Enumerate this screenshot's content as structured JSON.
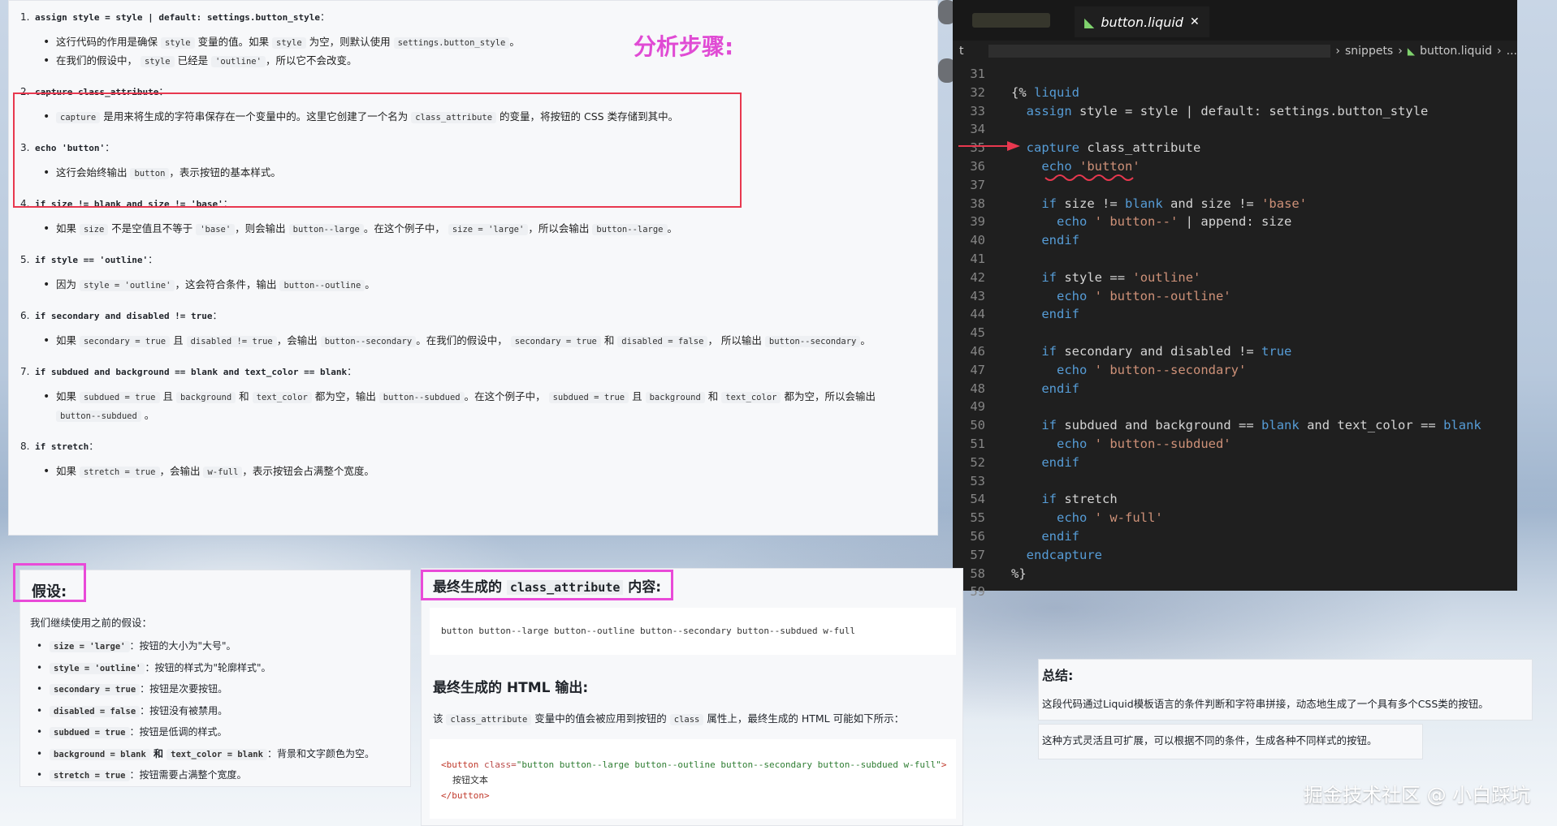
{
  "title_annotation": "分析步骤:",
  "steps": [
    {
      "num": "1.",
      "code": "assign style = style | default: settings.button_style",
      "tail": "：",
      "bullets": [
        {
          "parts": [
            {
              "t": "这行代码的作用是确保 "
            },
            {
              "c": "style"
            },
            {
              "t": " 变量的值。如果 "
            },
            {
              "c": "style"
            },
            {
              "t": " 为空，则默认使用 "
            },
            {
              "c": "settings.button_style"
            },
            {
              "t": "。"
            }
          ]
        },
        {
          "parts": [
            {
              "t": "在我们的假设中， "
            },
            {
              "c": "style"
            },
            {
              "t": " 已经是 "
            },
            {
              "c": "'outline'"
            },
            {
              "t": "，所以它不会改变。"
            }
          ]
        }
      ]
    },
    {
      "num": "2.",
      "code": "capture class_attribute",
      "tail": "：",
      "bullets": [
        {
          "parts": [
            {
              "c": "capture"
            },
            {
              "t": " 是用来将生成的字符串保存在一个变量中的。这里它创建了一个名为 "
            },
            {
              "c": "class_attribute"
            },
            {
              "t": " 的变量，将按钮的 CSS 类存储到其中。"
            }
          ]
        }
      ]
    },
    {
      "num": "3.",
      "code": "echo 'button'",
      "tail": "：",
      "bullets": [
        {
          "parts": [
            {
              "t": "这行会始终输出 "
            },
            {
              "c": "button"
            },
            {
              "t": "，表示按钮的基本样式。"
            }
          ]
        }
      ]
    },
    {
      "num": "4.",
      "code": "if size != blank and size != 'base'",
      "tail": "：",
      "bullets": [
        {
          "parts": [
            {
              "t": "如果 "
            },
            {
              "c": "size"
            },
            {
              "t": " 不是空值且不等于 "
            },
            {
              "c": "'base'"
            },
            {
              "t": "，则会输出 "
            },
            {
              "c": "button--large"
            },
            {
              "t": "。在这个例子中， "
            },
            {
              "c": "size = 'large'"
            },
            {
              "t": "，所以会输出 "
            },
            {
              "c": "button--large"
            },
            {
              "t": "。"
            }
          ]
        }
      ]
    },
    {
      "num": "5.",
      "code": "if style == 'outline'",
      "tail": "：",
      "bullets": [
        {
          "parts": [
            {
              "t": "因为 "
            },
            {
              "c": "style = 'outline'"
            },
            {
              "t": "，这会符合条件，输出 "
            },
            {
              "c": "button--outline"
            },
            {
              "t": "。"
            }
          ]
        }
      ]
    },
    {
      "num": "6.",
      "code": "if secondary and disabled != true",
      "tail": "：",
      "bullets": [
        {
          "parts": [
            {
              "t": "如果 "
            },
            {
              "c": "secondary = true"
            },
            {
              "t": " 且 "
            },
            {
              "c": "disabled != true"
            },
            {
              "t": "，会输出 "
            },
            {
              "c": "button--secondary"
            },
            {
              "t": "。在我们的假设中， "
            },
            {
              "c": "secondary = true"
            },
            {
              "t": " 和 "
            },
            {
              "c": "disabled = false"
            },
            {
              "t": "， 所以输出 "
            },
            {
              "c": "button--secondary"
            },
            {
              "t": "。"
            }
          ]
        }
      ]
    },
    {
      "num": "7.",
      "code": "if subdued and background == blank and text_color == blank",
      "tail": "：",
      "bullets": [
        {
          "parts": [
            {
              "t": "如果 "
            },
            {
              "c": "subdued = true"
            },
            {
              "t": " 且 "
            },
            {
              "c": "background"
            },
            {
              "t": " 和 "
            },
            {
              "c": "text_color"
            },
            {
              "t": " 都为空，输出 "
            },
            {
              "c": "button--subdued"
            },
            {
              "t": "。在这个例子中， "
            },
            {
              "c": "subdued = true"
            },
            {
              "t": " 且 "
            },
            {
              "c": "background"
            },
            {
              "t": " 和 "
            },
            {
              "c": "text_color"
            },
            {
              "t": " 都为空，所以会输出"
            }
          ],
          "continuation": "button--subdued"
        }
      ]
    },
    {
      "num": "8.",
      "code": "if stretch",
      "tail": "：",
      "bullets": [
        {
          "parts": [
            {
              "t": "如果 "
            },
            {
              "c": "stretch = true"
            },
            {
              "t": "，会输出 "
            },
            {
              "c": "w-full"
            },
            {
              "t": "，表示按钮会占满整个宽度。"
            }
          ]
        }
      ]
    }
  ],
  "editor": {
    "tab_label": "button.liquid",
    "tab_close": "✕",
    "breadcrumb_first": "t",
    "breadcrumb_folder": "snippets",
    "breadcrumb_file": "button.liquid",
    "breadcrumb_more": "...",
    "lines": [
      {
        "n": "31",
        "code": ""
      },
      {
        "n": "32",
        "code": "{% liquid"
      },
      {
        "n": "33",
        "code": "  assign style = style | default: settings.button_style"
      },
      {
        "n": "34",
        "code": ""
      },
      {
        "n": "35",
        "code": "  capture class_attribute"
      },
      {
        "n": "36",
        "code": "    echo 'button'"
      },
      {
        "n": "37",
        "code": ""
      },
      {
        "n": "38",
        "code": "    if size != blank and size != 'base'"
      },
      {
        "n": "39",
        "code": "      echo ' button--' | append: size"
      },
      {
        "n": "40",
        "code": "    endif"
      },
      {
        "n": "41",
        "code": ""
      },
      {
        "n": "42",
        "code": "    if style == 'outline'"
      },
      {
        "n": "43",
        "code": "      echo ' button--outline'"
      },
      {
        "n": "44",
        "code": "    endif"
      },
      {
        "n": "45",
        "code": ""
      },
      {
        "n": "46",
        "code": "    if secondary and disabled != true"
      },
      {
        "n": "47",
        "code": "      echo ' button--secondary'"
      },
      {
        "n": "48",
        "code": "    endif"
      },
      {
        "n": "49",
        "code": ""
      },
      {
        "n": "50",
        "code": "    if subdued and background == blank and text_color == blank"
      },
      {
        "n": "51",
        "code": "      echo ' button--subdued'"
      },
      {
        "n": "52",
        "code": "    endif"
      },
      {
        "n": "53",
        "code": ""
      },
      {
        "n": "54",
        "code": "    if stretch"
      },
      {
        "n": "55",
        "code": "      echo ' w-full'"
      },
      {
        "n": "56",
        "code": "    endif"
      },
      {
        "n": "57",
        "code": "  endcapture"
      },
      {
        "n": "58",
        "code": "%}"
      },
      {
        "n": "59",
        "code": ""
      }
    ]
  },
  "assumption": {
    "title": "假设:",
    "intro": "我们继续使用之前的假设：",
    "items": [
      {
        "c": "size = 'large'",
        "t": "：按钮的大小为\"大号\"。"
      },
      {
        "c": "style = 'outline'",
        "t": "：按钮的样式为\"轮廓样式\"。"
      },
      {
        "c": "secondary = true",
        "t": "：按钮是次要按钮。"
      },
      {
        "c": "disabled = false",
        "t": "：按钮没有被禁用。"
      },
      {
        "c": "subdued = true",
        "t": "：按钮是低调的样式。"
      },
      {
        "c": "background = blank",
        "mid": " 和 ",
        "c2": "text_color = blank",
        "t": "：背景和文字颜色为空。"
      },
      {
        "c": "stretch = true",
        "t": "：按钮需要占满整个宽度。"
      }
    ]
  },
  "result": {
    "title_pre": "最终生成的 ",
    "title_code": "class_attribute",
    "title_post": " 内容:",
    "class_output": "button button--large button--outline button--secondary button--subdued w-full",
    "html_title": "最终生成的 HTML 输出:",
    "desc_pre": "该 ",
    "desc_code1": "class_attribute",
    "desc_mid": " 变量中的值会被应用到按钮的 ",
    "desc_code2": "class",
    "desc_post": " 属性上，最终生成的 HTML 可能如下所示：",
    "html_line1_tag": "<button",
    "html_line1_attr": " class=",
    "html_line1_val": "\"button button--large button--outline button--secondary button--subdued w-full\"",
    "html_line1_end": ">",
    "html_line2": "按钮文本",
    "html_line3": "</button>"
  },
  "summary": {
    "title": "总结:",
    "p1": "这段代码通过Liquid模板语言的条件判断和字符串拼接，动态地生成了一个具有多个CSS类的按钮。",
    "p2": "这种方式灵活且可扩展，可以根据不同的条件，生成各种不同样式的按钮。"
  },
  "watermark": "掘金技术社区 @ 小白踩坑",
  "colors": {
    "red_box": "#e8384f",
    "pink_box": "#e94ad8",
    "annotation": "#e04bd4",
    "editor_bg": "#1f1f1f"
  }
}
